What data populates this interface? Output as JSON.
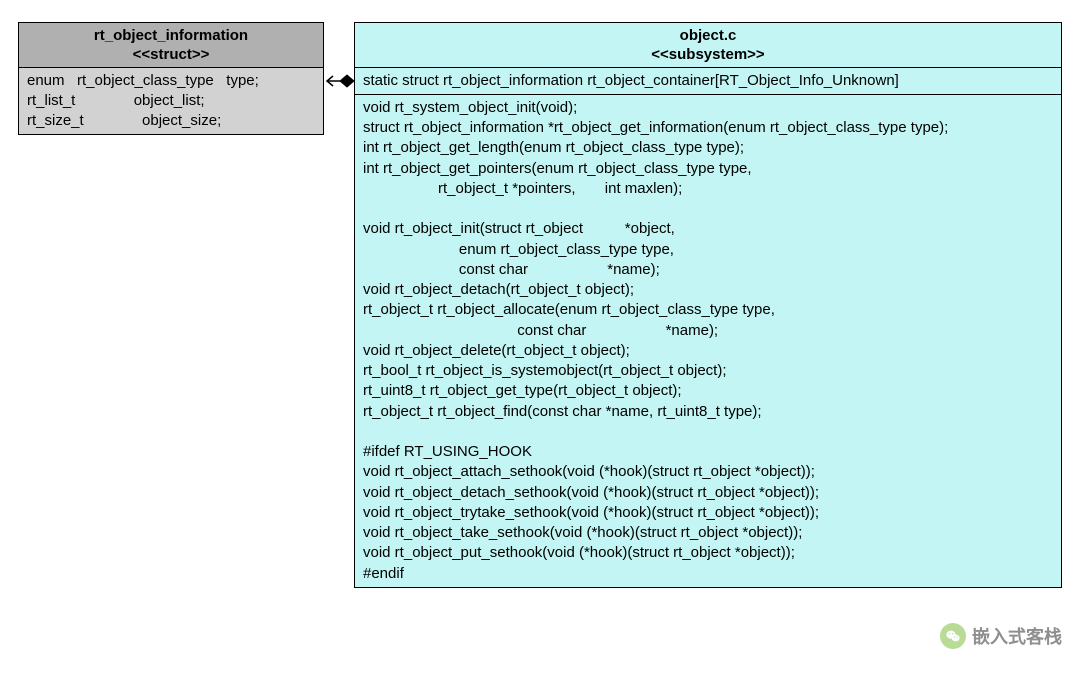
{
  "struct": {
    "title": "rt_object_information",
    "stereotype": "<<struct>>",
    "fields": "enum   rt_object_class_type   type;\nrt_list_t              object_list;\nrt_size_t              object_size;"
  },
  "subsystem": {
    "title": "object.c",
    "stereotype": "<<subsystem>>",
    "declaration": "static struct rt_object_information rt_object_container[RT_Object_Info_Unknown]",
    "body": "void rt_system_object_init(void);\nstruct rt_object_information *rt_object_get_information(enum rt_object_class_type type);\nint rt_object_get_length(enum rt_object_class_type type);\nint rt_object_get_pointers(enum rt_object_class_type type,\n                  rt_object_t *pointers,       int maxlen);\n\nvoid rt_object_init(struct rt_object          *object,\n                       enum rt_object_class_type type,\n                       const char                   *name);\nvoid rt_object_detach(rt_object_t object);\nrt_object_t rt_object_allocate(enum rt_object_class_type type,\n                                     const char                   *name);\nvoid rt_object_delete(rt_object_t object);\nrt_bool_t rt_object_is_systemobject(rt_object_t object);\nrt_uint8_t rt_object_get_type(rt_object_t object);\nrt_object_t rt_object_find(const char *name, rt_uint8_t type);\n\n#ifdef RT_USING_HOOK\nvoid rt_object_attach_sethook(void (*hook)(struct rt_object *object));\nvoid rt_object_detach_sethook(void (*hook)(struct rt_object *object));\nvoid rt_object_trytake_sethook(void (*hook)(struct rt_object *object));\nvoid rt_object_take_sethook(void (*hook)(struct rt_object *object));\nvoid rt_object_put_sethook(void (*hook)(struct rt_object *object));\n#endif"
  },
  "watermark": {
    "text": "嵌入式客栈"
  }
}
